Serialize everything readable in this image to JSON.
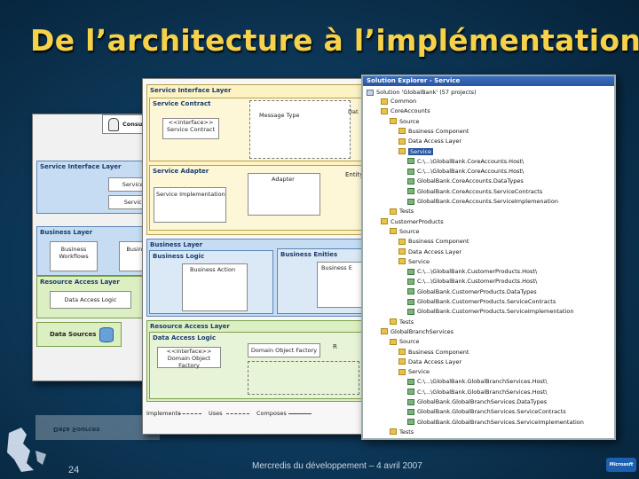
{
  "title": "De l’architecture à l’implémentation",
  "left_diagram": {
    "consumer": "Consu",
    "service_interface_layer": "Service Interface Layer",
    "service_co": "Service Co",
    "service_a": "Service A",
    "business_layer": "Business Layer",
    "business_workflows": "Business Workflows",
    "business_logic": "Busine Logi",
    "resource_access_layer": "Resource Access Layer",
    "data_access_logic": "Data Access Logic",
    "data_sources": "Data Sources",
    "reflection": "Data Sources"
  },
  "middle_diagram": {
    "service_interface_layer": "Service Interface Layer",
    "service_contract": "Service Contract",
    "interface_stereo": "<<interface>>",
    "service_contract_box": "Service Contract",
    "message_type": "Message Type",
    "service_adapter": "Service Adapter",
    "service_implementation": "Service Implementation",
    "adapter": "Adapter",
    "entity": "Entity",
    "dat": "Dat",
    "business_layer": "Business Layer",
    "business_logic": "Business Logic",
    "business_entities": "Business Enities",
    "business_action": "Business Action",
    "business_e": "Business E",
    "resource_access_layer": "Resource Access Layer",
    "data_access_logic": "Data Access Logic",
    "interface_stereo2": "<<interface>>",
    "domain_object_factory": "Domain Object Factory",
    "domain_object_factory2": "Domain Object Factory",
    "r": "R",
    "legend_implements": "Implements",
    "legend_uses": "Uses",
    "legend_composes": "Composes"
  },
  "solution_explorer": {
    "title": "Solution Explorer - Service",
    "solution": "Solution 'GlobalBank' (57 projects)",
    "items": [
      {
        "label": "Common",
        "level": 1,
        "icon": "fold"
      },
      {
        "label": "CoreAccounts",
        "level": 1,
        "icon": "fold"
      },
      {
        "label": "Source",
        "level": 2,
        "icon": "fold"
      },
      {
        "label": "Business Component",
        "level": 3,
        "icon": "fold"
      },
      {
        "label": "Data Access Layer",
        "level": 3,
        "icon": "fold"
      },
      {
        "label": "Service",
        "level": 3,
        "icon": "fold",
        "selected": true
      },
      {
        "label": "C:\\...\\GlobalBank.CoreAccounts.Host\\",
        "level": 4,
        "icon": "cs"
      },
      {
        "label": "C:\\...\\GlobalBank.CoreAccounts.Host\\",
        "level": 4,
        "icon": "cs"
      },
      {
        "label": "GlobalBank.CoreAccounts.DataTypes",
        "level": 4,
        "icon": "cs"
      },
      {
        "label": "GlobalBank.CoreAccounts.ServiceContracts",
        "level": 4,
        "icon": "cs"
      },
      {
        "label": "GlobalBank.CoreAccounts.ServiceImplemenation",
        "level": 4,
        "icon": "cs"
      },
      {
        "label": "Tests",
        "level": 2,
        "icon": "fold"
      },
      {
        "label": "CustomerProducts",
        "level": 1,
        "icon": "fold"
      },
      {
        "label": "Source",
        "level": 2,
        "icon": "fold"
      },
      {
        "label": "Business Component",
        "level": 3,
        "icon": "fold"
      },
      {
        "label": "Data Access Layer",
        "level": 3,
        "icon": "fold"
      },
      {
        "label": "Service",
        "level": 3,
        "icon": "fold"
      },
      {
        "label": "C:\\...\\GlobalBank.CustomerProducts.Host\\",
        "level": 4,
        "icon": "cs"
      },
      {
        "label": "C:\\...\\GlobalBank.CustomerProducts.Host\\",
        "level": 4,
        "icon": "cs"
      },
      {
        "label": "GlobalBank.CustomerProducts.DataTypes",
        "level": 4,
        "icon": "cs"
      },
      {
        "label": "GlobalBank.CustomerProducts.ServiceContracts",
        "level": 4,
        "icon": "cs"
      },
      {
        "label": "GlobalBank.CustomerProducts.ServiceImplementation",
        "level": 4,
        "icon": "cs"
      },
      {
        "label": "Tests",
        "level": 2,
        "icon": "fold"
      },
      {
        "label": "GlobalBranchServices",
        "level": 1,
        "icon": "fold"
      },
      {
        "label": "Source",
        "level": 2,
        "icon": "fold"
      },
      {
        "label": "Business Component",
        "level": 3,
        "icon": "fold"
      },
      {
        "label": "Data Access Layer",
        "level": 3,
        "icon": "fold"
      },
      {
        "label": "Service",
        "level": 3,
        "icon": "fold"
      },
      {
        "label": "C:\\...\\GlobalBank.GlobalBranchServices.Host\\",
        "level": 4,
        "icon": "cs"
      },
      {
        "label": "C:\\...\\GlobalBank.GlobalBranchServices.Host\\",
        "level": 4,
        "icon": "cs"
      },
      {
        "label": "GlobalBank.GlobalBranchServices.DataTypes",
        "level": 4,
        "icon": "cs"
      },
      {
        "label": "GlobalBank.GlobalBranchServices.ServiceContracts",
        "level": 4,
        "icon": "cs"
      },
      {
        "label": "GlobalBank.GlobalBranchServices.ServiceImplementation",
        "level": 4,
        "icon": "cs"
      },
      {
        "label": "Tests",
        "level": 2,
        "icon": "fold"
      }
    ]
  },
  "footer": {
    "page_number": "24",
    "text": "Mercredis du développement – 4 avril 2007",
    "logo_text": "Microsoft"
  }
}
